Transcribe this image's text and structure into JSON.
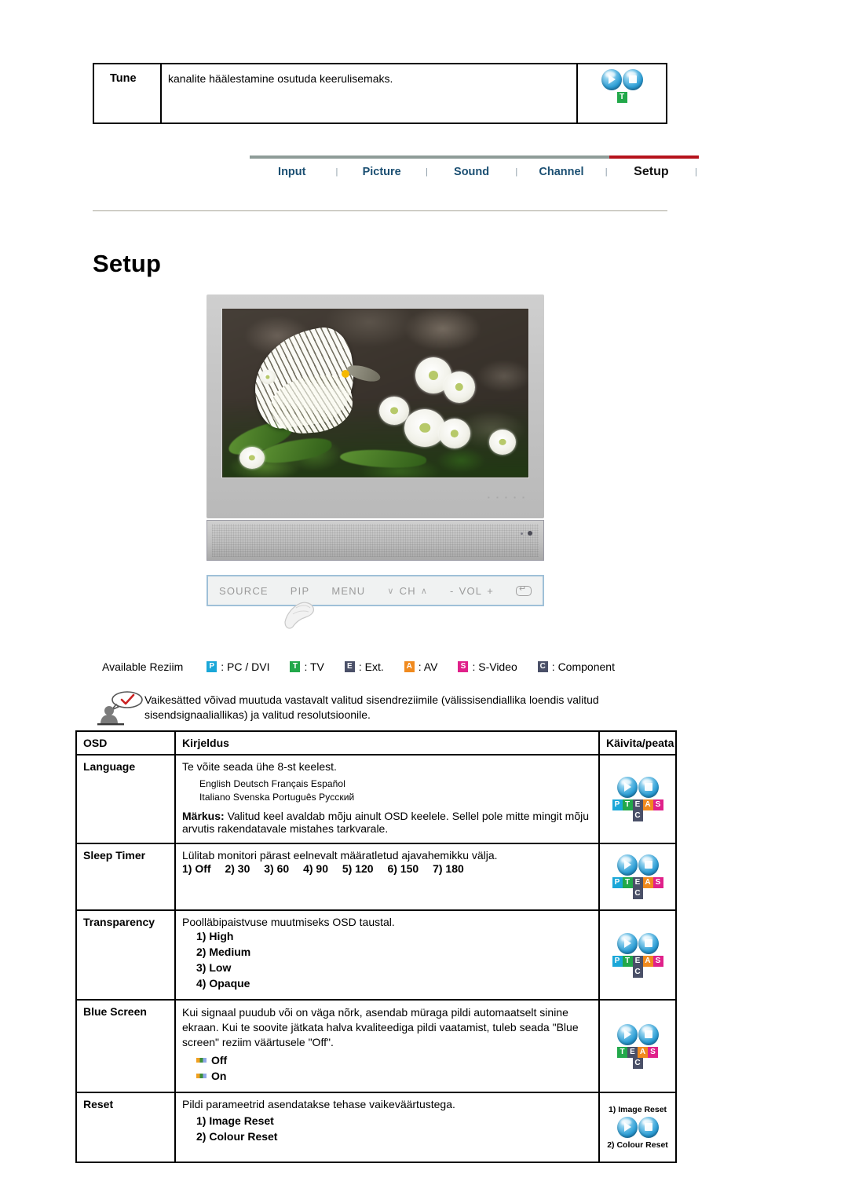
{
  "tune_row": {
    "label": "Tune",
    "description": "kanalite häälestamine osutuda keerulisemaks.",
    "modes": [
      "T"
    ]
  },
  "nav": {
    "tabs": [
      {
        "label": "Input",
        "active": false
      },
      {
        "label": "Picture",
        "active": false
      },
      {
        "label": "Sound",
        "active": false
      },
      {
        "label": "Channel",
        "active": false
      },
      {
        "label": "Setup",
        "active": true
      }
    ],
    "separator": "|",
    "active_color": "#b5121b",
    "line_color": "#8e9c98"
  },
  "page_title": "Setup",
  "monitor": {
    "controls": [
      "SOURCE",
      "PIP",
      "MENU"
    ],
    "channel": {
      "down": "∨",
      "label": "CH",
      "up": "∧"
    },
    "volume": {
      "minus": "-",
      "label": "VOL",
      "plus": "+"
    },
    "enter_icon": "enter-icon"
  },
  "available": {
    "label": "Available Reziim",
    "modes": [
      {
        "key": "P",
        "text": ": PC / DVI",
        "color": "#1aa7d8"
      },
      {
        "key": "T",
        "text": ": TV",
        "color": "#22a84a"
      },
      {
        "key": "E",
        "text": ": Ext.",
        "color": "#4a5068"
      },
      {
        "key": "A",
        "text": ": AV",
        "color": "#f08a1e"
      },
      {
        "key": "S",
        "text": ": S-Video",
        "color": "#e0218a"
      },
      {
        "key": "C",
        "text": ": Component",
        "color": "#4a5068"
      }
    ]
  },
  "note": {
    "icon": "note-person-icon",
    "text": "Vaikesätted võivad muutuda vastavalt valitud sisendreziimile (välissisendiallika loendis valitud sisendsignaaliallikas) ja valitud resolutsioonile."
  },
  "table": {
    "headers": [
      "OSD",
      "Kirjeldus",
      "Käivita/peata"
    ],
    "rows": [
      {
        "osd": "Language",
        "desc": "Te võite seada ühe 8-st keelest.",
        "languages_line1": "English  Deutsch  Français  Español",
        "languages_line2": "Italiano Svenska  Português  Русский",
        "note_label": "Märkus:",
        "note_text": " Valitud keel avaldab mõju ainult OSD keelele. Sellel pole mitte mingit mõju arvutis rakendatavale mistahes tarkvarale.",
        "modes": [
          "P",
          "T",
          "E",
          "A",
          "S",
          "C"
        ]
      },
      {
        "osd": "Sleep Timer",
        "desc": "Lülitab monitori pärast eelnevalt määratletud ajavahemikku välja.",
        "inline_options": [
          "1) Off",
          "2) 30",
          "3) 60",
          "4) 90",
          "5) 120",
          "6) 150",
          "7) 180"
        ],
        "modes": [
          "P",
          "T",
          "E",
          "A",
          "S",
          "C"
        ]
      },
      {
        "osd": "Transparency",
        "desc": "Poolläbipaistvuse muutmiseks OSD taustal.",
        "options": [
          "1) High",
          "2) Medium",
          "3) Low",
          "4) Opaque"
        ],
        "modes": [
          "P",
          "T",
          "E",
          "A",
          "S",
          "C"
        ]
      },
      {
        "osd": "Blue Screen",
        "desc": "Kui signaal puudub või on väga nõrk, asendab müraga pildi automaatselt sinine ekraan. Kui te soovite jätkata halva kvaliteediga pildi vaatamist, tuleb seada \"Blue screen\" reziim väärtusele \"Off\".",
        "bullets": [
          "Off",
          "On"
        ],
        "modes": [
          "T",
          "E",
          "A",
          "S",
          "C"
        ]
      },
      {
        "osd": "Reset",
        "desc": "Pildi parameetrid asendatakse tehase vaikeväärtustega.",
        "options": [
          "1) Image Reset",
          "2) Colour Reset"
        ],
        "icon_top_label": "1) Image Reset",
        "icon_bottom_label": "2) Colour Reset"
      }
    ]
  },
  "badge_colors": {
    "P": "#1aa7d8",
    "T": "#22a84a",
    "E": "#4a5068",
    "A": "#f08a1e",
    "S": "#e0218a",
    "C": "#4a5068"
  }
}
